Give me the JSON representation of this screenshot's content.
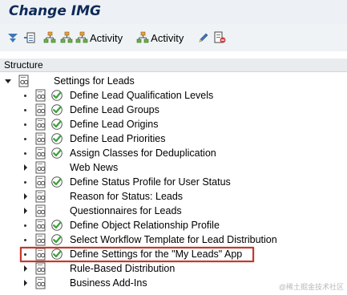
{
  "window": {
    "title": "Change IMG"
  },
  "toolbar": {
    "activity_label_1": "Activity",
    "activity_label_2": "Activity"
  },
  "header": {
    "structure": "Structure"
  },
  "tree": {
    "root": {
      "label": "Settings for Leads"
    },
    "items": [
      {
        "label": "Define Lead Qualification Levels",
        "marker": "dot",
        "check": true
      },
      {
        "label": "Define Lead Groups",
        "marker": "dot",
        "check": true
      },
      {
        "label": "Define Lead Origins",
        "marker": "dot",
        "check": true
      },
      {
        "label": "Define Lead Priorities",
        "marker": "dot",
        "check": true
      },
      {
        "label": "Assign Classes for Deduplication",
        "marker": "dot",
        "check": true
      },
      {
        "label": "Web News",
        "marker": "arrow",
        "check": false
      },
      {
        "label": "Define Status Profile for User Status",
        "marker": "dot",
        "check": true
      },
      {
        "label": "Reason for Status: Leads",
        "marker": "arrow",
        "check": false
      },
      {
        "label": "Questionnaires for Leads",
        "marker": "arrow",
        "check": false
      },
      {
        "label": "Define Object Relationship Profile",
        "marker": "dot",
        "check": true
      },
      {
        "label": "Select Workflow Template for Lead Distribution",
        "marker": "dot",
        "check": true
      },
      {
        "label": "Define Settings for the \"My Leads\" App",
        "marker": "dot",
        "check": true
      },
      {
        "label": "Rule-Based Distribution",
        "marker": "arrow",
        "check": false
      },
      {
        "label": "Business Add-Ins",
        "marker": "arrow",
        "check": false
      }
    ]
  },
  "watermark": "@稀土掘金技术社区",
  "colors": {
    "title": "#0f2a58",
    "highlight": "#c0392b",
    "check": "#3aa23a",
    "toolbar_bg": "#eff3f6"
  }
}
